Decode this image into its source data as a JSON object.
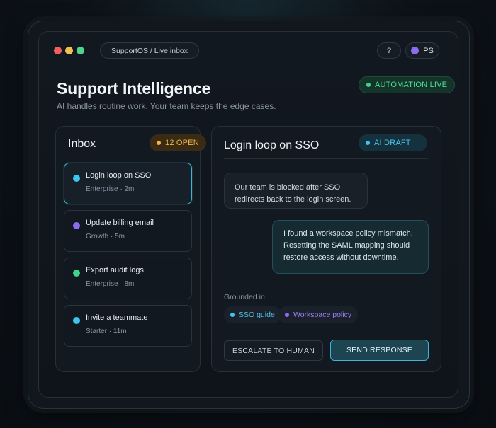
{
  "header": {
    "breadcrumb": "SupportOS / Live inbox",
    "help_label": "?",
    "avatar_initials": "PS"
  },
  "hero": {
    "title": "Support Intelligence",
    "subtitle": "AI handles routine work. Your team keeps the edge cases.",
    "automation_badge": "AUTOMATION LIVE"
  },
  "inbox": {
    "title": "Inbox",
    "open_badge": "12 OPEN",
    "items": [
      {
        "title": "Login loop on SSO",
        "meta": "Enterprise · 2m",
        "color": "#3cc6ef"
      },
      {
        "title": "Update billing email",
        "meta": "Growth · 5m",
        "color": "#8b6cf0"
      },
      {
        "title": "Export audit logs",
        "meta": "Enterprise · 8m",
        "color": "#3fd48e"
      },
      {
        "title": "Invite a teammate",
        "meta": "Starter · 11m",
        "color": "#3cc6ef"
      }
    ]
  },
  "conversation": {
    "title": "Login loop on SSO",
    "ai_badge": "AI DRAFT",
    "customer_message": [
      "Our team is blocked after SSO",
      "redirects back to the login screen."
    ],
    "ai_message": [
      "I found a workspace policy mismatch.",
      "Resetting the SAML mapping should",
      "restore access without downtime."
    ],
    "grounded_label": "Grounded in",
    "sources": [
      {
        "label": "SSO guide",
        "color": "#3cc6ef"
      },
      {
        "label": "Workspace policy",
        "color": "#8b6cf0"
      }
    ],
    "escalate_label": "ESCALATE TO HUMAN",
    "send_label": "SEND RESPONSE"
  },
  "colors": {
    "accent": "#3fb5d6",
    "live_green": "#3fd48e",
    "open_amber": "#f0b44c"
  }
}
